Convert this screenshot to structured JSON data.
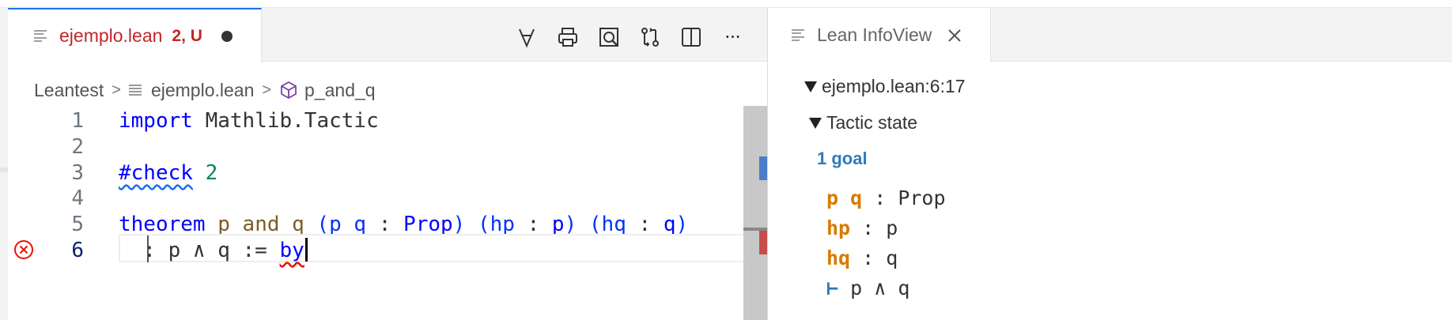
{
  "editor": {
    "tab": {
      "filename": "ejemplo.lean",
      "badge": "2, U"
    },
    "actions": [
      "forall-icon",
      "print-icon",
      "search-preview-icon",
      "git-compare-icon",
      "split-editor-icon",
      "more-actions-icon"
    ],
    "more_label": "···",
    "breadcrumb": {
      "root": "Leantest",
      "sep": ">",
      "file": "ejemplo.lean",
      "symbol": "p_and_q"
    },
    "lines": [
      {
        "num": "1"
      },
      {
        "num": "2"
      },
      {
        "num": "3"
      },
      {
        "num": "4"
      },
      {
        "num": "5"
      },
      {
        "num": "6"
      }
    ],
    "code": {
      "l1_kw": "import",
      "l1_rest": " Mathlib.Tactic",
      "l3_cmd": "#check",
      "l3_num": " 2",
      "l5_kw": "theorem",
      "l5_name": " p_and_q",
      "l5_g1_open": " (p q ",
      "l5_g1_colon": ":",
      "l5_g1_type": " Prop",
      "l5_g1_close": ")",
      "l5_g2_open": " (hp ",
      "l5_g2_colon": ":",
      "l5_g2_type": " p",
      "l5_g2_close": ")",
      "l5_g3_open": " (hq ",
      "l5_g3_colon": ":",
      "l5_g3_type": " q",
      "l5_g3_close": ")",
      "l6_rest": "  : p ∧ q := ",
      "l6_by": "by"
    }
  },
  "infoview": {
    "tab_label": "Lean InfoView",
    "location": "ejemplo.lean:6:17",
    "tactic_state_label": "Tactic state",
    "goal_count": "1 goal",
    "hypotheses": [
      {
        "names": "p q",
        "sep": " : ",
        "type": "Prop"
      },
      {
        "names": "hp",
        "sep": " : ",
        "type": "p"
      },
      {
        "names": "hq",
        "sep": " : ",
        "type": "q"
      }
    ],
    "goal": {
      "turnstile": "⊢",
      "type": " p ∧ q"
    }
  },
  "colors": {
    "tab_error": "#c0262b",
    "keyword": "#0000ff",
    "number": "#098658",
    "identifier": "#795e26",
    "hyp_name": "#d97a00",
    "goal_blue": "#2f7bbd",
    "error_red": "#e51400"
  }
}
